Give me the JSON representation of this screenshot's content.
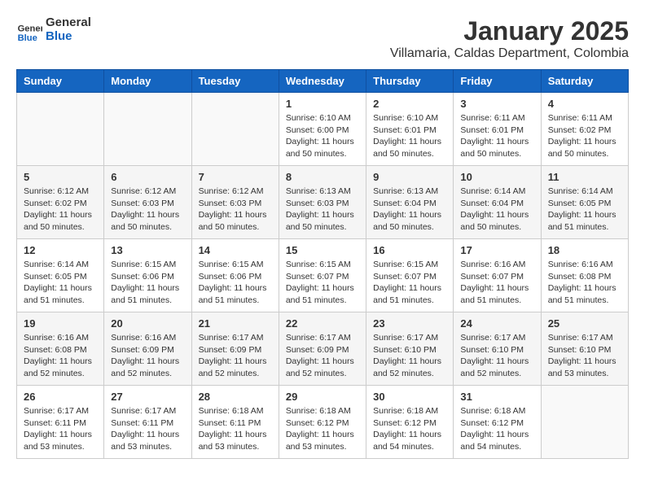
{
  "logo": {
    "general": "General",
    "blue": "Blue"
  },
  "title": "January 2025",
  "subtitle": "Villamaria, Caldas Department, Colombia",
  "weekdays": [
    "Sunday",
    "Monday",
    "Tuesday",
    "Wednesday",
    "Thursday",
    "Friday",
    "Saturday"
  ],
  "weeks": [
    [
      {
        "day": "",
        "info": ""
      },
      {
        "day": "",
        "info": ""
      },
      {
        "day": "",
        "info": ""
      },
      {
        "day": "1",
        "info": "Sunrise: 6:10 AM\nSunset: 6:00 PM\nDaylight: 11 hours\nand 50 minutes."
      },
      {
        "day": "2",
        "info": "Sunrise: 6:10 AM\nSunset: 6:01 PM\nDaylight: 11 hours\nand 50 minutes."
      },
      {
        "day": "3",
        "info": "Sunrise: 6:11 AM\nSunset: 6:01 PM\nDaylight: 11 hours\nand 50 minutes."
      },
      {
        "day": "4",
        "info": "Sunrise: 6:11 AM\nSunset: 6:02 PM\nDaylight: 11 hours\nand 50 minutes."
      }
    ],
    [
      {
        "day": "5",
        "info": "Sunrise: 6:12 AM\nSunset: 6:02 PM\nDaylight: 11 hours\nand 50 minutes."
      },
      {
        "day": "6",
        "info": "Sunrise: 6:12 AM\nSunset: 6:03 PM\nDaylight: 11 hours\nand 50 minutes."
      },
      {
        "day": "7",
        "info": "Sunrise: 6:12 AM\nSunset: 6:03 PM\nDaylight: 11 hours\nand 50 minutes."
      },
      {
        "day": "8",
        "info": "Sunrise: 6:13 AM\nSunset: 6:03 PM\nDaylight: 11 hours\nand 50 minutes."
      },
      {
        "day": "9",
        "info": "Sunrise: 6:13 AM\nSunset: 6:04 PM\nDaylight: 11 hours\nand 50 minutes."
      },
      {
        "day": "10",
        "info": "Sunrise: 6:14 AM\nSunset: 6:04 PM\nDaylight: 11 hours\nand 50 minutes."
      },
      {
        "day": "11",
        "info": "Sunrise: 6:14 AM\nSunset: 6:05 PM\nDaylight: 11 hours\nand 51 minutes."
      }
    ],
    [
      {
        "day": "12",
        "info": "Sunrise: 6:14 AM\nSunset: 6:05 PM\nDaylight: 11 hours\nand 51 minutes."
      },
      {
        "day": "13",
        "info": "Sunrise: 6:15 AM\nSunset: 6:06 PM\nDaylight: 11 hours\nand 51 minutes."
      },
      {
        "day": "14",
        "info": "Sunrise: 6:15 AM\nSunset: 6:06 PM\nDaylight: 11 hours\nand 51 minutes."
      },
      {
        "day": "15",
        "info": "Sunrise: 6:15 AM\nSunset: 6:07 PM\nDaylight: 11 hours\nand 51 minutes."
      },
      {
        "day": "16",
        "info": "Sunrise: 6:15 AM\nSunset: 6:07 PM\nDaylight: 11 hours\nand 51 minutes."
      },
      {
        "day": "17",
        "info": "Sunrise: 6:16 AM\nSunset: 6:07 PM\nDaylight: 11 hours\nand 51 minutes."
      },
      {
        "day": "18",
        "info": "Sunrise: 6:16 AM\nSunset: 6:08 PM\nDaylight: 11 hours\nand 51 minutes."
      }
    ],
    [
      {
        "day": "19",
        "info": "Sunrise: 6:16 AM\nSunset: 6:08 PM\nDaylight: 11 hours\nand 52 minutes."
      },
      {
        "day": "20",
        "info": "Sunrise: 6:16 AM\nSunset: 6:09 PM\nDaylight: 11 hours\nand 52 minutes."
      },
      {
        "day": "21",
        "info": "Sunrise: 6:17 AM\nSunset: 6:09 PM\nDaylight: 11 hours\nand 52 minutes."
      },
      {
        "day": "22",
        "info": "Sunrise: 6:17 AM\nSunset: 6:09 PM\nDaylight: 11 hours\nand 52 minutes."
      },
      {
        "day": "23",
        "info": "Sunrise: 6:17 AM\nSunset: 6:10 PM\nDaylight: 11 hours\nand 52 minutes."
      },
      {
        "day": "24",
        "info": "Sunrise: 6:17 AM\nSunset: 6:10 PM\nDaylight: 11 hours\nand 52 minutes."
      },
      {
        "day": "25",
        "info": "Sunrise: 6:17 AM\nSunset: 6:10 PM\nDaylight: 11 hours\nand 53 minutes."
      }
    ],
    [
      {
        "day": "26",
        "info": "Sunrise: 6:17 AM\nSunset: 6:11 PM\nDaylight: 11 hours\nand 53 minutes."
      },
      {
        "day": "27",
        "info": "Sunrise: 6:17 AM\nSunset: 6:11 PM\nDaylight: 11 hours\nand 53 minutes."
      },
      {
        "day": "28",
        "info": "Sunrise: 6:18 AM\nSunset: 6:11 PM\nDaylight: 11 hours\nand 53 minutes."
      },
      {
        "day": "29",
        "info": "Sunrise: 6:18 AM\nSunset: 6:12 PM\nDaylight: 11 hours\nand 53 minutes."
      },
      {
        "day": "30",
        "info": "Sunrise: 6:18 AM\nSunset: 6:12 PM\nDaylight: 11 hours\nand 54 minutes."
      },
      {
        "day": "31",
        "info": "Sunrise: 6:18 AM\nSunset: 6:12 PM\nDaylight: 11 hours\nand 54 minutes."
      },
      {
        "day": "",
        "info": ""
      }
    ]
  ]
}
